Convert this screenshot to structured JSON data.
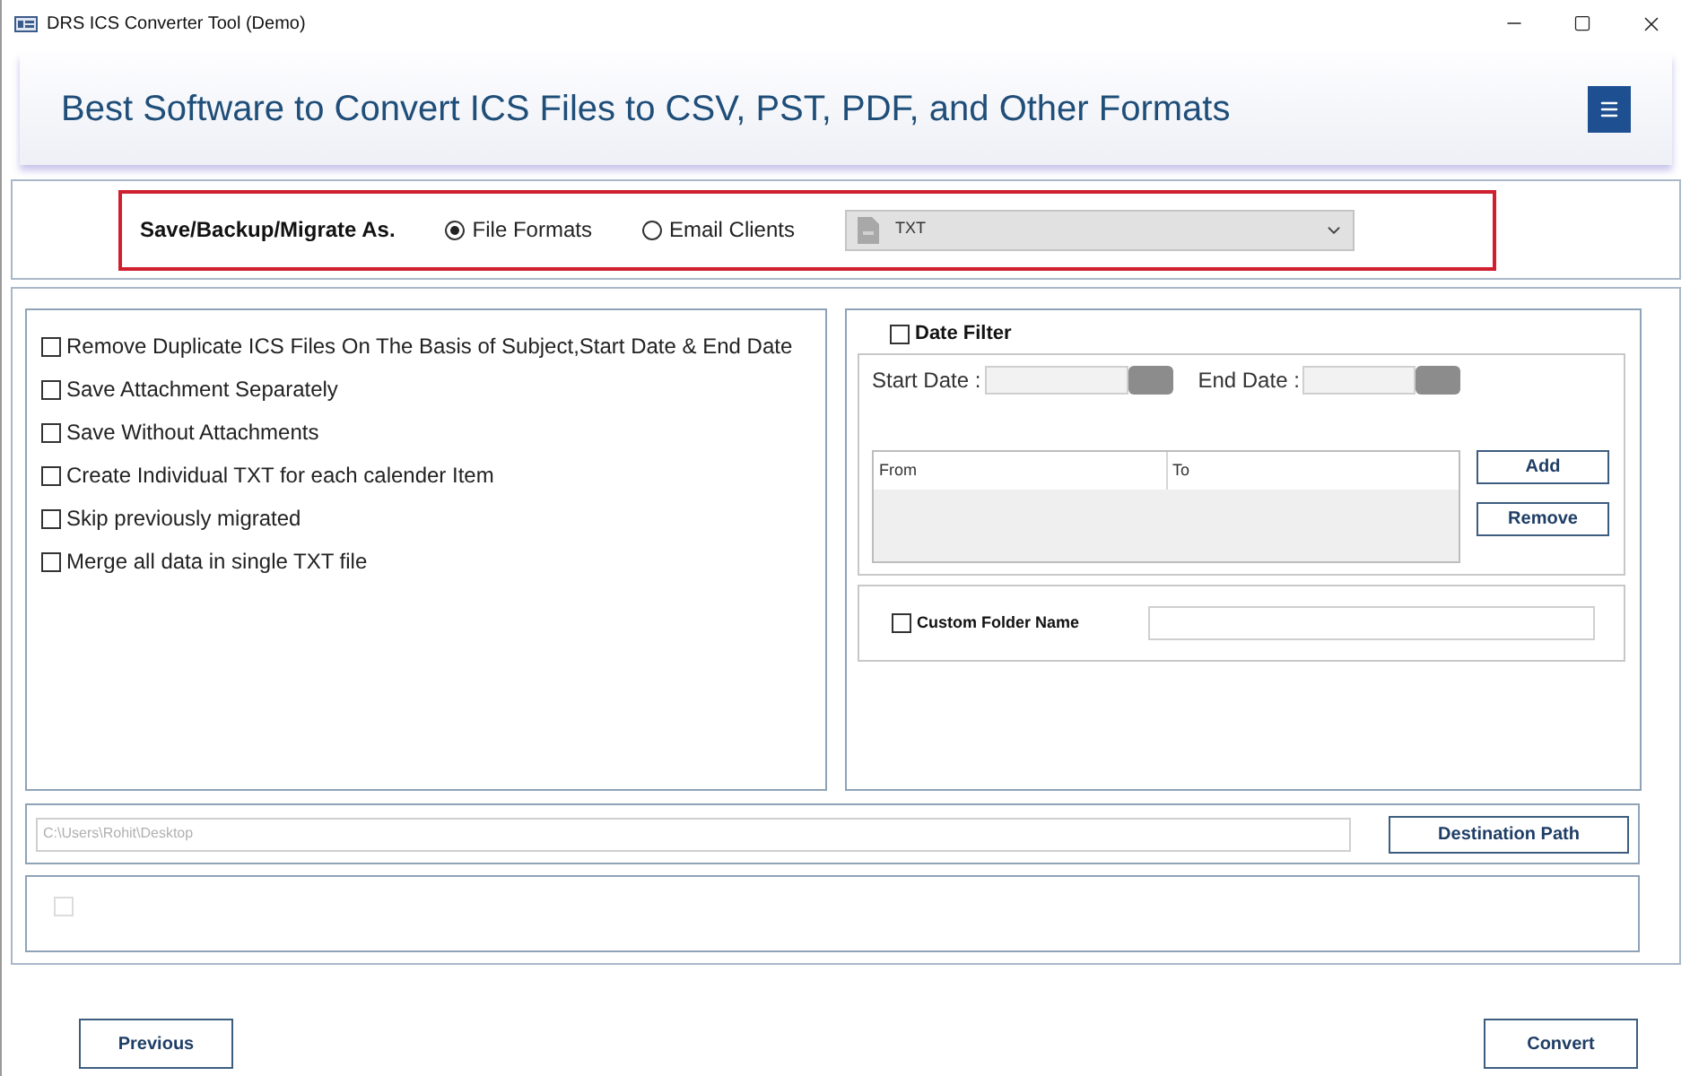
{
  "window": {
    "title": "DRS ICS Converter Tool (Demo)"
  },
  "header": {
    "title": "Best Software to Convert ICS Files to CSV, PST, PDF, and Other Formats"
  },
  "save_as": {
    "label": "Save/Backup/Migrate As.",
    "options": [
      {
        "label": "File Formats",
        "selected": true
      },
      {
        "label": "Email Clients",
        "selected": false
      }
    ],
    "format_select": {
      "value": "TXT"
    }
  },
  "options": [
    {
      "label": "Remove Duplicate ICS Files On The Basis of Subject,Start Date & End Date",
      "checked": false
    },
    {
      "label": "Save Attachment Separately",
      "checked": false
    },
    {
      "label": "Save Without Attachments",
      "checked": false
    },
    {
      "label": "Create Individual TXT for each calender Item",
      "checked": false
    },
    {
      "label": "Skip previously migrated",
      "checked": false
    },
    {
      "label": "Merge all data in single TXT file",
      "checked": false
    }
  ],
  "date_filter": {
    "label": "Date Filter",
    "checked": false,
    "start_label": "Start Date :",
    "end_label": "End Date :",
    "table": {
      "columns": [
        "From",
        "To"
      ]
    },
    "buttons": [
      "Add",
      "Remove"
    ]
  },
  "custom_folder": {
    "label": "Custom Folder Name",
    "checked": false
  },
  "destination": {
    "path": "C:\\Users\\Rohit\\Desktop",
    "button": "Destination Path"
  },
  "status_checkbox": {
    "checked": false,
    "disabled": true
  },
  "footer": {
    "buttons": [
      "Previous",
      "Convert"
    ]
  }
}
